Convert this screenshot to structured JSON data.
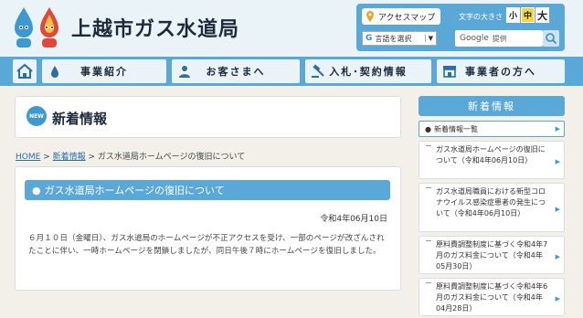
{
  "header": {
    "site_title": "上越市ガス水道局",
    "access_map": "アクセスマップ",
    "font_size_label": "文字の大きさ",
    "size_small": "小",
    "size_medium": "中",
    "size_large": "大",
    "translate_label": "言語を選択",
    "search_brand": "Google",
    "search_suffix": "提供"
  },
  "nav": {
    "items": [
      {
        "label": "事業紹介"
      },
      {
        "label": "お客さまへ"
      },
      {
        "label": "入札･契約情報"
      },
      {
        "label": "事業者の方へ"
      }
    ]
  },
  "main": {
    "new_badge": "NEW",
    "title": "新着情報",
    "breadcrumb": {
      "home": "HOME",
      "sep": ">",
      "parent": "新着情報",
      "current": "ガス水道局ホームページの復旧について"
    },
    "article": {
      "heading": "ガス水道局ホームページの復旧について",
      "date": "令和4年06月10日",
      "body": "６月１０日（金曜日）、ガス水道局のホームページが不正アクセスを受け、一部のページが改ざんされたことに伴い、一時ホームページを閉鎖しましたが、同日午後７時にホームページを復旧しました。"
    }
  },
  "sidebar": {
    "heading": "新着情報",
    "list_all": "新着情報一覧",
    "items": [
      {
        "text": "ガス水道局ホームページの復旧について（令和4年06月10日）"
      },
      {
        "text": "ガス水道局職員における新型コロナウイルス感染症患者の発生について（令和4年06月10日）"
      },
      {
        "text": "原料費調整制度に基づく令和4年7月のガス料金について（令和4年05月30日）"
      },
      {
        "text": "原料費調整制度に基づく令和4年6月のガス料金について（令和4年04月28日）"
      }
    ]
  },
  "colors": {
    "accent": "#5aa8d8",
    "header_bg": "#e9f3f8",
    "page_bg": "#f3f0ea"
  }
}
